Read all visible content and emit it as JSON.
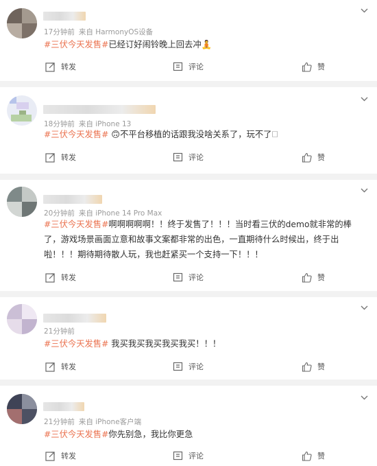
{
  "actions": {
    "share": "转发",
    "comment": "评论",
    "like": "赞"
  },
  "colors": {
    "topic": "#eb7350",
    "meta": "#9a9a9a"
  },
  "icons": [
    "share-icon",
    "comment-icon",
    "like-icon",
    "chevron-down-icon"
  ],
  "posts": [
    {
      "name_visible": "F",
      "time": "17分钟前",
      "source": "来自 HarmonyOS设备",
      "tag": "#三伏今天发售#",
      "body": "已经订好闹铃晚上回去冲🧘"
    },
    {
      "name_visible": "",
      "time": "18分钟前",
      "source": "来自 iPhone 13",
      "tag": "#三伏今天发售#",
      "body": " 🙃不平台移植的话跟我没啥关系了，玩不了🗆"
    },
    {
      "name_visible": "",
      "time": "20分钟前",
      "source": "来自 iPhone 14 Pro Max",
      "tag": "#三伏今天发售#",
      "body": "啊啊啊啊啊！！终于发售了！！！当时看三伏的demo就非常的棒了，游戏场景画面立意和故事文案都非常的出色，一直期待什么时候出，终于出啦！！！期待期待散人玩，我也赶紧买一个支持一下！！！"
    },
    {
      "name_visible": "",
      "time": "21分钟前",
      "source": "",
      "tag": "#三伏今天发售#",
      "body": " 我买我买我买我买我买！！！"
    },
    {
      "name_visible": "",
      "time": "21分钟前",
      "source": "来自 iPhone客户端",
      "tag": "#三伏今天发售#",
      "body": "你先别急，我比你更急"
    }
  ]
}
